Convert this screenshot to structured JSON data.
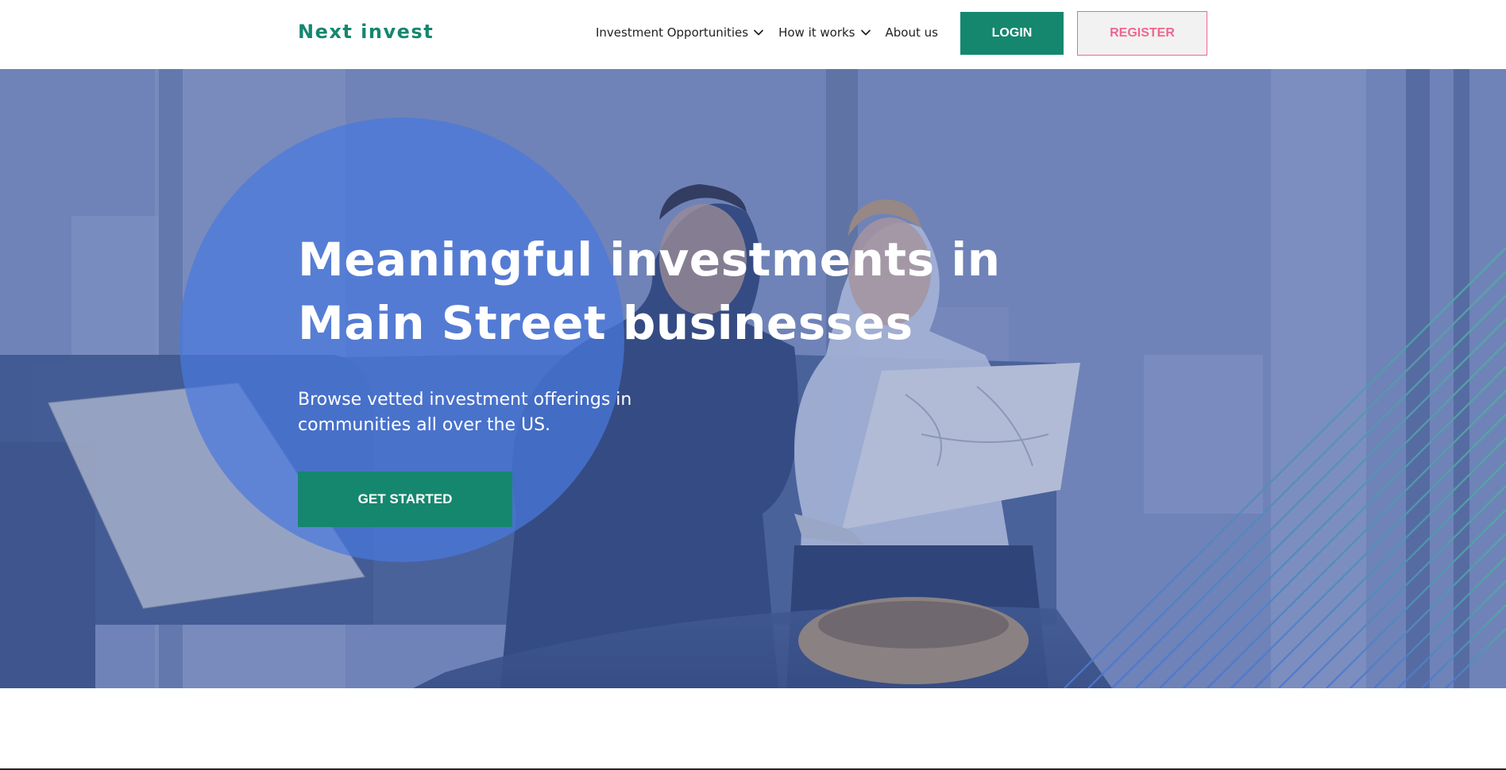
{
  "header": {
    "logo": "Next invest",
    "nav": [
      {
        "label": "Investment Opportunities",
        "has_dropdown": true,
        "icon": "chevron-down-icon"
      },
      {
        "label": "How it works",
        "has_dropdown": true,
        "icon": "chevron-down-icon"
      },
      {
        "label": "About us",
        "has_dropdown": false
      }
    ],
    "login_label": "LOGIN",
    "register_label": "REGISTER"
  },
  "hero": {
    "title_line1": "Meaningful investments in",
    "title_line2": "Main Street businesses",
    "subtitle_line1": "Browse vetted investment offerings in",
    "subtitle_line2": "communities all over the US.",
    "cta_label": "GET STARTED"
  },
  "colors": {
    "brand_green": "#15876f",
    "register_pink": "#f0678c",
    "hero_circle_blue": "#4a78de",
    "hero_overlay": "#7387b8"
  }
}
